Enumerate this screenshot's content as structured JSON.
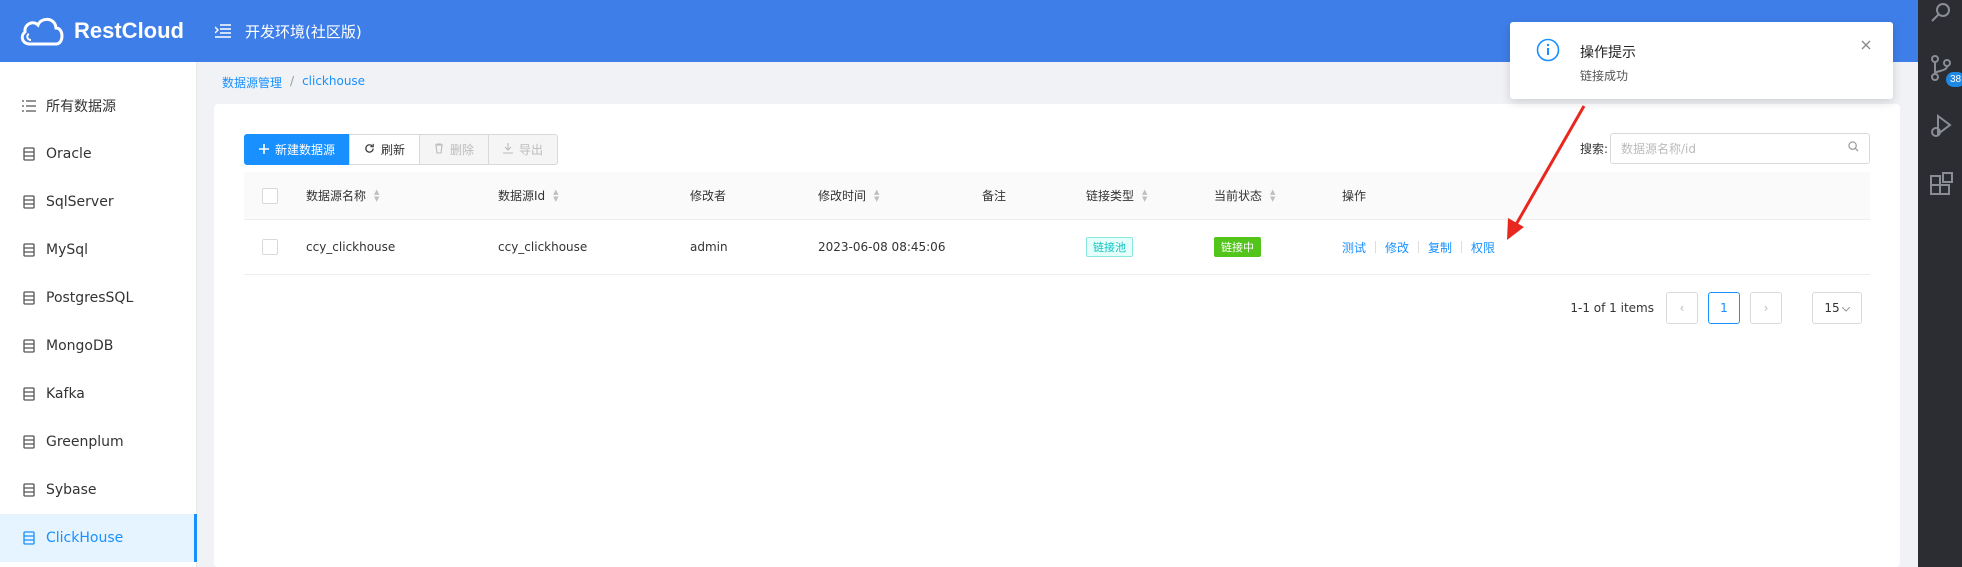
{
  "header": {
    "logo_text": "RestCloud",
    "env_title": "开发环境(社区版)"
  },
  "ide": {
    "badge": "38"
  },
  "sidebar": {
    "items": [
      {
        "label": "所有数据源",
        "icon": "list-icon"
      },
      {
        "label": "Oracle",
        "icon": "database-icon"
      },
      {
        "label": "SqlServer",
        "icon": "database-icon"
      },
      {
        "label": "MySql",
        "icon": "database-icon"
      },
      {
        "label": "PostgresSQL",
        "icon": "database-icon"
      },
      {
        "label": "MongoDB",
        "icon": "database-icon"
      },
      {
        "label": "Kafka",
        "icon": "database-icon"
      },
      {
        "label": "Greenplum",
        "icon": "database-icon"
      },
      {
        "label": "Sybase",
        "icon": "database-icon"
      },
      {
        "label": "ClickHouse",
        "icon": "database-icon",
        "active": true
      }
    ]
  },
  "breadcrumb": {
    "root": "数据源管理",
    "sep": "/",
    "current": "clickhouse"
  },
  "toolbar": {
    "new_label": "新建数据源",
    "refresh_label": "刷新",
    "delete_label": "删除",
    "export_label": "导出"
  },
  "search": {
    "label": "搜索:",
    "placeholder": "数据源名称/id"
  },
  "table": {
    "headers": {
      "name": "数据源名称",
      "id": "数据源Id",
      "modifier": "修改者",
      "modified": "修改时间",
      "remark": "备注",
      "conn_type": "链接类型",
      "status": "当前状态",
      "ops": "操作"
    },
    "rows": [
      {
        "name": "ccy_clickhouse",
        "id": "ccy_clickhouse",
        "modifier": "admin",
        "modified": "2023-06-08 08:45:06",
        "remark": "",
        "conn_type": "链接池",
        "status": "链接中",
        "ops": {
          "test": "测试",
          "edit": "修改",
          "copy": "复制",
          "perm": "权限"
        }
      }
    ]
  },
  "pagination": {
    "total": "1-1 of 1 items",
    "current": "1",
    "page_size": "15"
  },
  "toast": {
    "title": "操作提示",
    "message": "链接成功"
  },
  "colors": {
    "header_bg": "#3e7ee8",
    "primary": "#1890ff",
    "status_green": "#52c41a",
    "tag_cyan": "#13c2c2",
    "annotation_red": "#e8281e"
  }
}
